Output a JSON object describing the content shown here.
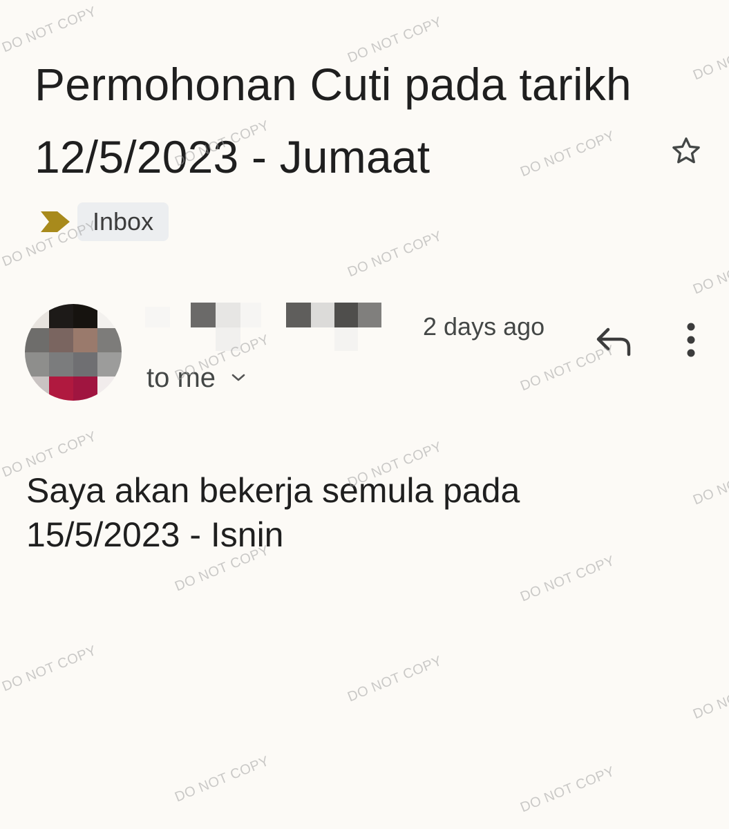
{
  "email": {
    "subject": "Permohonan Cuti pada tarikh 12/5/2023 - Jumaat",
    "label": "Inbox",
    "time": "2 days ago",
    "recipients": "to me",
    "body": "Saya akan bekerja semula pada 15/5/2023 - Isnin"
  },
  "icons": {
    "star": "star-outline-icon",
    "reply": "reply-icon",
    "more": "more-vertical-icon",
    "expand": "chevron-down-icon",
    "label_marker": "important-marker-icon"
  },
  "colors": {
    "background": "#fcfaf6",
    "important_marker": "#a88a1c",
    "chip_background": "#eceef0"
  },
  "watermark": {
    "text": "DO NOT COPY"
  }
}
